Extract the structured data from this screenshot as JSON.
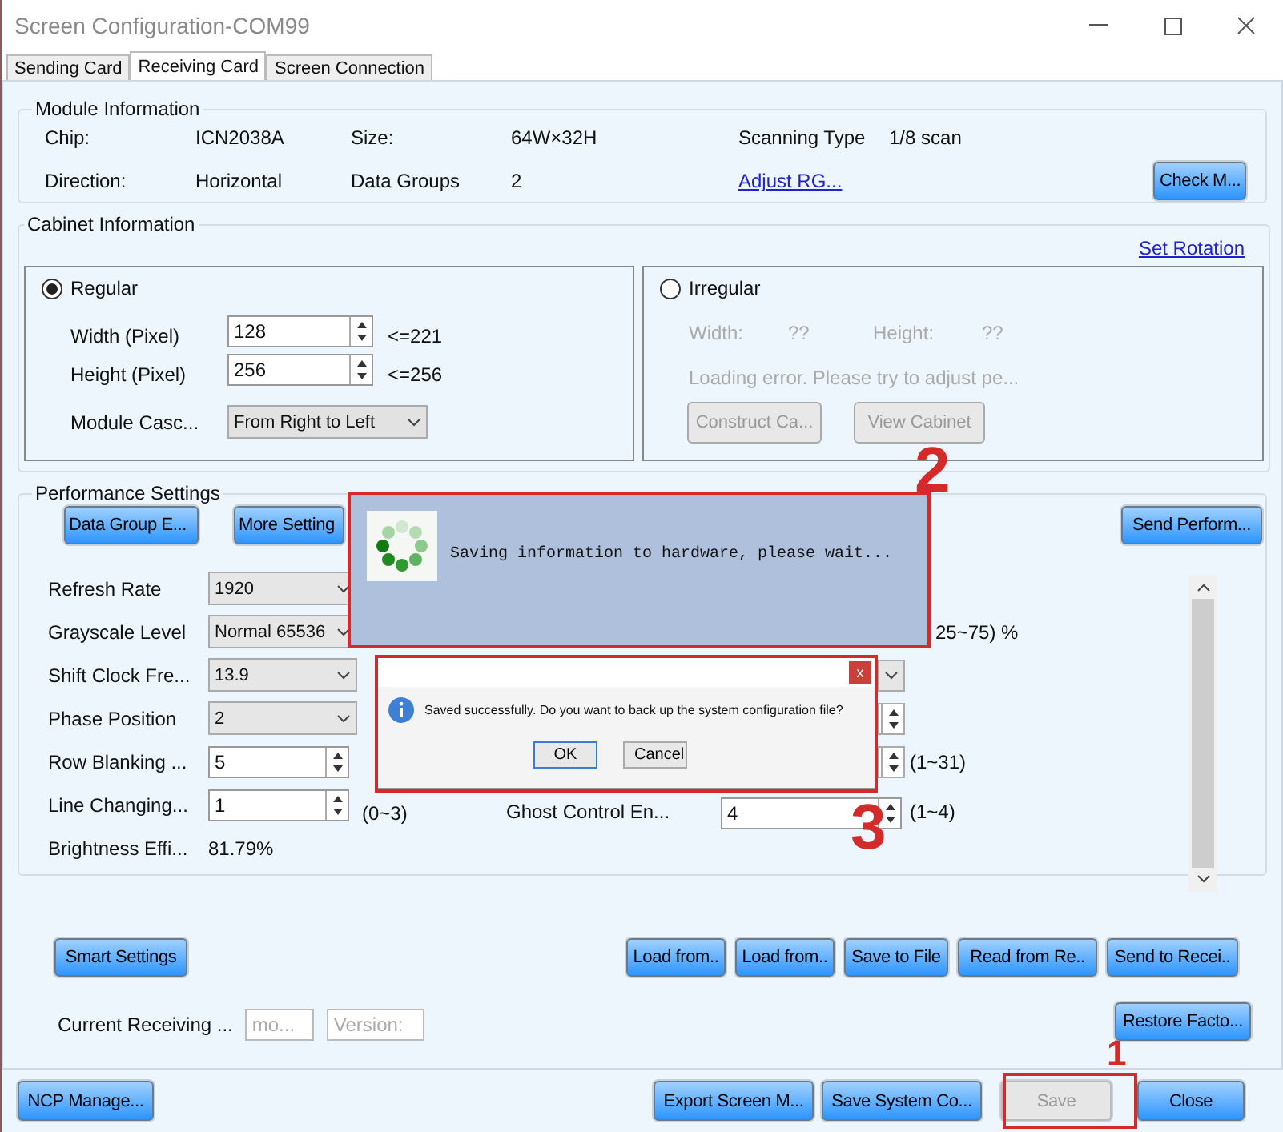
{
  "window": {
    "title": "Screen Configuration-COM99"
  },
  "tabs": [
    {
      "label": "Sending Card",
      "selected": false
    },
    {
      "label": "Receiving Card",
      "selected": true
    },
    {
      "label": "Screen Connection",
      "selected": false
    }
  ],
  "module_info": {
    "title": "Module Information",
    "rows": [
      [
        {
          "label": "Chip:",
          "value": "ICN2038A"
        },
        {
          "label": "Size:",
          "value": "64W×32H"
        },
        {
          "label": "Scanning Type",
          "value": "1/8 scan"
        }
      ],
      [
        {
          "label": "Direction:",
          "value": "Horizontal"
        },
        {
          "label": "Data Groups",
          "value": "2"
        }
      ]
    ],
    "link": "Adjust RG...",
    "button": "Check M..."
  },
  "cabinet": {
    "title": "Cabinet Information",
    "link": "Set Rotation",
    "regular": {
      "label": "Regular",
      "selected": true,
      "fields": [
        {
          "label": "Width (Pixel)",
          "value": "128",
          "limit": "<=221"
        },
        {
          "label": "Height (Pixel)",
          "value": "256",
          "limit": "<=256"
        }
      ],
      "cascade": {
        "label": "Module Casc...",
        "value": "From Right to Left"
      }
    },
    "irregular": {
      "label": "Irregular",
      "selected": false,
      "disabled": true,
      "width_label": "Width:",
      "width_value": "??",
      "height_label": "Height:",
      "height_value": "??",
      "message": "Loading error. Please try to adjust pe...",
      "buttons": [
        "Construct Ca...",
        "View Cabinet"
      ]
    }
  },
  "performance": {
    "title": "Performance Settings",
    "buttons": [
      "Data Group E...",
      "More Setting"
    ],
    "send_button": "Send Perform...",
    "left": [
      {
        "label": "Refresh Rate",
        "kind": "select",
        "value": "1920"
      },
      {
        "label": "Grayscale Level",
        "kind": "select",
        "value": "Normal 65536"
      },
      {
        "label": "Shift Clock Fre...",
        "kind": "select",
        "value": "13.9"
      },
      {
        "label": "Phase Position",
        "kind": "select",
        "value": "2"
      },
      {
        "label": "Row Blanking ...",
        "kind": "spin",
        "value": "5"
      },
      {
        "label": "Line Changing...",
        "kind": "spin",
        "value": "1",
        "range": "(0~3)"
      },
      {
        "label": "Brightness Effi...",
        "kind": "text",
        "value": "81.79%"
      }
    ],
    "right": [
      {
        "kind": "input",
        "range": "25~75) %"
      },
      {
        "kind": "select"
      },
      {
        "kind": "spin"
      },
      {
        "kind": "spin",
        "range": "(1~31)"
      },
      {
        "kind": "spin",
        "label": "Ghost Control En...",
        "value": "4",
        "range": "(1~4)"
      }
    ]
  },
  "smart_button": "Smart Settings",
  "actions": [
    "Load from..",
    "Load from..",
    "Save to File",
    "Read from Re..",
    "Send to Recei.."
  ],
  "current": {
    "label": "Current Receiving ...",
    "fields": [
      "mo...",
      "Version:"
    ]
  },
  "restore_button": "Restore Facto...",
  "footer": {
    "left_button": "NCP Manage...",
    "buttons": [
      {
        "label": "Export Screen M...",
        "disabled": false
      },
      {
        "label": "Save System Co...",
        "disabled": false
      },
      {
        "label": "Save",
        "disabled": true
      },
      {
        "label": "Close",
        "disabled": false
      }
    ]
  },
  "saving_dialog": {
    "message": "Saving information to hardware, please wait..."
  },
  "message_box": {
    "close": "x",
    "text": "Saved successfully. Do you want to back up the system configuration file?",
    "buttons": [
      "OK",
      "Cancel"
    ]
  },
  "annotations": [
    {
      "label": "1"
    },
    {
      "label": "2"
    },
    {
      "label": "3"
    }
  ]
}
